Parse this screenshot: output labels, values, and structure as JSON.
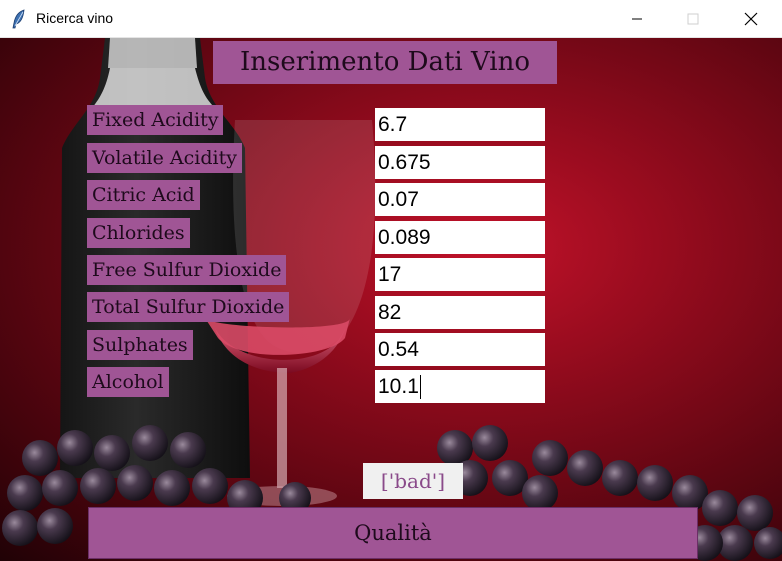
{
  "window": {
    "title": "Ricerca vino",
    "controls": {
      "minimize": "minimize-icon",
      "maximize": "maximize-icon",
      "close": "close-icon"
    }
  },
  "form": {
    "heading": "Inserimento Dati Vino",
    "fields": [
      {
        "label": "Fixed Acidity",
        "value": "6.7"
      },
      {
        "label": "Volatile Acidity",
        "value": "0.675"
      },
      {
        "label": "Citric Acid",
        "value": "0.07"
      },
      {
        "label": "Chlorides",
        "value": "0.089"
      },
      {
        "label": "Free Sulfur Dioxide",
        "value": "17"
      },
      {
        "label": "Total Sulfur Dioxide",
        "value": "82"
      },
      {
        "label": "Sulphates",
        "value": "0.54"
      },
      {
        "label": "Alcohol",
        "value": "10.1"
      }
    ],
    "result": "['bad']",
    "button_label": "Qualità"
  },
  "colors": {
    "label_bg": "#a05595",
    "background": "#9a0c1f"
  }
}
